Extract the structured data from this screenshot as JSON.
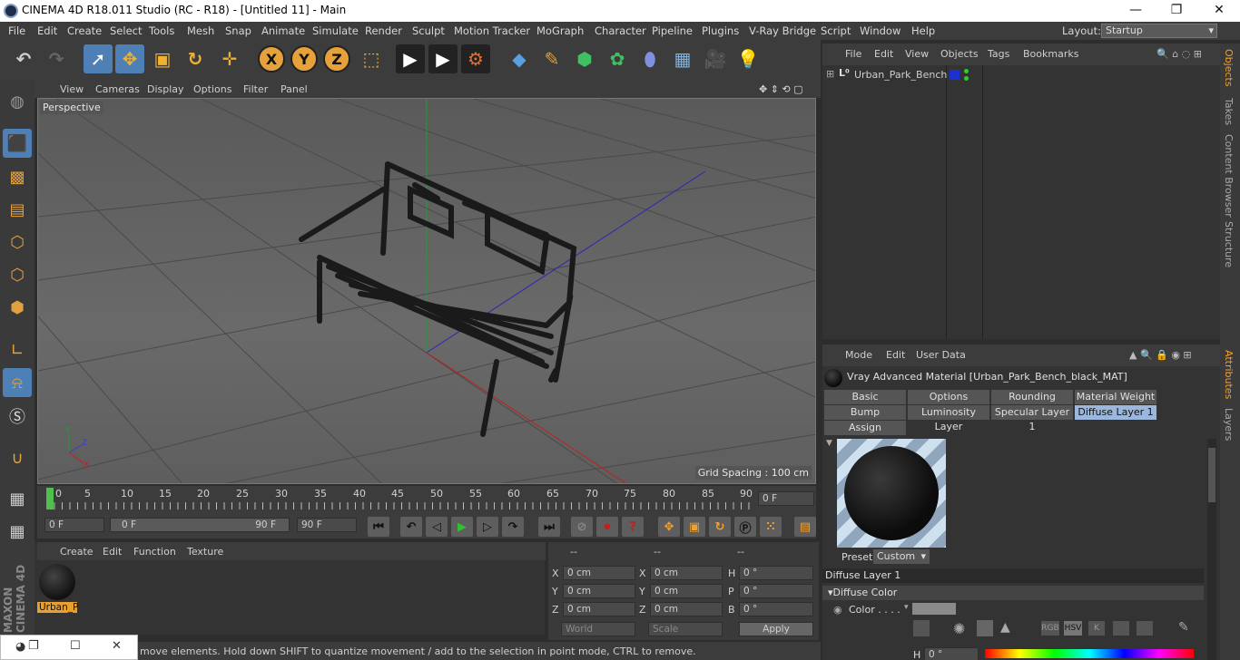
{
  "window": {
    "title": "CINEMA 4D R18.011 Studio (RC - R18) - [Untitled 11] - Main",
    "min": "—",
    "restore": "❐",
    "close": "✕"
  },
  "menu": [
    "File",
    "Edit",
    "Create",
    "Select",
    "Tools",
    "Mesh",
    "Snap",
    "Animate",
    "Simulate",
    "Render",
    "Sculpt",
    "Motion Tracker",
    "MoGraph",
    "Character",
    "Pipeline",
    "Plugins",
    "V-Ray Bridge",
    "Script",
    "Window",
    "Help"
  ],
  "layout": {
    "label": "Layout:",
    "value": "Startup"
  },
  "toolbar": {
    "x": "X",
    "y": "Y",
    "z": "Z"
  },
  "viewport": {
    "menu": [
      "View",
      "Cameras",
      "Display",
      "Options",
      "Filter",
      "Panel"
    ],
    "label": "Perspective",
    "grid": "Grid Spacing : 100 cm"
  },
  "timeline": {
    "ticks": [
      "0",
      "5",
      "10",
      "15",
      "20",
      "25",
      "30",
      "35",
      "40",
      "45",
      "50",
      "55",
      "60",
      "65",
      "70",
      "75",
      "80",
      "85",
      "90"
    ],
    "end_field": "0 F"
  },
  "transport": {
    "start": "0 F",
    "range_left": "0 F",
    "range_right": "90 F",
    "end": "90 F"
  },
  "matmgr": {
    "menu": [
      "Create",
      "Edit",
      "Function",
      "Texture"
    ],
    "mat_label": "Urban_P"
  },
  "coords": {
    "headers": [
      "--",
      "--",
      "--"
    ],
    "rows": [
      {
        "a": "X",
        "av": "0 cm",
        "b": "X",
        "bv": "0 cm",
        "c": "H",
        "cv": "0 °"
      },
      {
        "a": "Y",
        "av": "0 cm",
        "b": "Y",
        "bv": "0 cm",
        "c": "P",
        "cv": "0 °"
      },
      {
        "a": "Z",
        "av": "0 cm",
        "b": "Z",
        "bv": "0 cm",
        "c": "B",
        "cv": "0 °"
      }
    ],
    "world": "World",
    "scale": "Scale",
    "apply": "Apply"
  },
  "status": "move elements. Hold down SHIFT to quantize movement / add to the selection in point mode, CTRL to remove.",
  "objects": {
    "menu": [
      "File",
      "Edit",
      "View",
      "Objects",
      "Tags",
      "Bookmarks"
    ],
    "item": "Urban_Park_Bench"
  },
  "sidetabs": {
    "right_top": [
      "Objects",
      "Takes",
      "Content Browser",
      "Structure"
    ],
    "right_bottom": [
      "Attributes",
      "Layers"
    ]
  },
  "attributes": {
    "menu": [
      "Mode",
      "Edit",
      "User Data"
    ],
    "title": "Vray Advanced Material [Urban_Park_Bench_black_MAT]",
    "tabs": [
      "Basic",
      "Options",
      "Rounding",
      "Material Weight",
      "Bump",
      "Luminosity Layer",
      "Specular Layer 1",
      "Diffuse Layer 1",
      "Assign"
    ],
    "preset_label": "Preset",
    "preset_value": "Custom",
    "section": "Diffuse Layer 1",
    "subsection": "Diffuse Color",
    "color_label": "Color . . . .",
    "h_label": "H",
    "h_value": "0 °",
    "mode_btns": [
      "RGB",
      "HSV",
      "K"
    ]
  },
  "leftlogo": "MAXON CINEMA 4D"
}
